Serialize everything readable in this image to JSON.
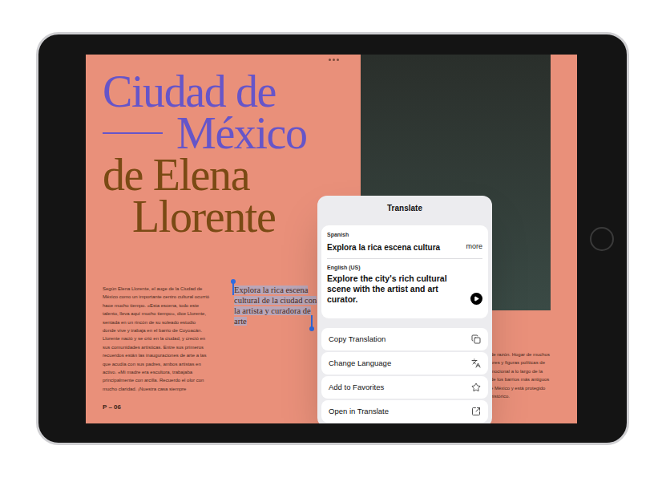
{
  "magazine": {
    "title_lines": [
      {
        "text": "Ciudad de",
        "color": "#6655c9",
        "kind": "plain"
      },
      {
        "text": "México",
        "color": "#6655c9",
        "kind": "ruled"
      },
      {
        "text": "de Elena",
        "color": "#7a4a14",
        "kind": "plain"
      },
      {
        "text": "Llorente",
        "color": "#7a4a14",
        "kind": "indented"
      }
    ],
    "body_text": "Según Elena Llorente, el auge de la Ciudad de México como un importante centro cultural ocurrió hace mucho tiempo. «Esta escena, todo este talento, lleva aquí mucho tiempo», dice Llorente, sentada en un rincón de su soleado estudio donde vive y trabaja en el barrio de Coyoacán. Llorente nació y se crió en la ciudad, y creció en sus comunidades artísticas. Entre sus primeros recuerdos están las inauguraciones de arte a las que acudía con sus padres, ambos artistas en activo. «Mi madre era escultora, trabajaba principalmente con arcilla. Recuerdo el olor con mucho claridad. ¡Nuestra casa siempre",
    "pull_quote": {
      "text": "Explora la rica escena cultural de la ciudad con la artista y curadora de arte",
      "selected": true
    },
    "right_column_lines": [
      "de razón. Hogar de muchos",
      "ores y figuras políticas de",
      "mocional a lo largo de la",
      "de los barrios más antiguos",
      "e México y está protegido",
      "histórico."
    ],
    "page_number": "P – 06"
  },
  "translate_popup": {
    "title": "Translate",
    "source": {
      "language": "Spanish",
      "text": "Explora la rica escena cultura",
      "more": "more"
    },
    "target": {
      "language": "English (US)",
      "text": "Explore the city's rich cultural scene with the artist and art curator."
    },
    "actions": [
      {
        "label": "Copy Translation",
        "icon": "copy"
      },
      {
        "label": "Change Language",
        "icon": "language"
      },
      {
        "label": "Add to Favorites",
        "icon": "star"
      },
      {
        "label": "Open in Translate",
        "icon": "open"
      }
    ]
  }
}
